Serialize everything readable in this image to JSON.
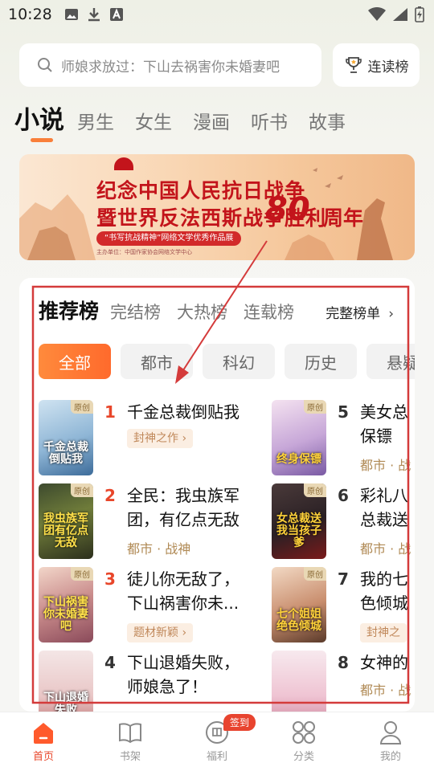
{
  "status_bar": {
    "time": "10:28"
  },
  "search": {
    "placeholder": "师娘求放过：下山去祸害你未婚妻吧",
    "rank_button": "连读榜"
  },
  "category_tabs": [
    "小说",
    "男生",
    "女生",
    "漫画",
    "听书",
    "故事"
  ],
  "banner": {
    "line1": "纪念中国人民抗日战争",
    "line2": "暨世界反法西斯战争胜利",
    "number": "80",
    "suffix": "周年",
    "tag": "“书写抗战精神”网络文学优秀作品展",
    "footer": "主办单位：中国作家协会网络文学中心"
  },
  "ranking": {
    "tabs": [
      "推荐榜",
      "完结榜",
      "大热榜",
      "连载榜"
    ],
    "full_list": "完整榜单",
    "genres": [
      "全部",
      "都市",
      "科幻",
      "历史",
      "悬疑"
    ]
  },
  "books": [
    {
      "rank": "1",
      "title": "千金总裁倒贴我",
      "tag": "封神之作",
      "cover_title": "千金总裁倒贴我",
      "badge": "原创"
    },
    {
      "rank": "2",
      "title": "全民：我虫族军团，有亿点无敌",
      "meta": "都市 · 战神",
      "cover_title": "我虫族军团有亿点无敌",
      "badge": "原创"
    },
    {
      "rank": "3",
      "title": "徒儿你无敌了，下山祸害你未...",
      "tag": "题材新颖",
      "cover_title": "下山祸害你未婚妻吧",
      "badge": "原创"
    },
    {
      "rank": "4",
      "title": "下山退婚失败，师娘急了！",
      "cover_title": "下山退婚失败"
    },
    {
      "rank": "5",
      "title": "美女总保镖",
      "meta": "都市 · 战",
      "cover_title": "终身保镖",
      "badge": "原创"
    },
    {
      "rank": "6",
      "title": "彩礼八总裁送",
      "meta": "都市 · 战",
      "cover_title": "女总裁送我当孩子爹",
      "badge": "原创"
    },
    {
      "rank": "7",
      "title": "我的七色倾城",
      "tag": "封神之",
      "cover_title": "七个姐姐绝色倾城",
      "badge": "原创"
    },
    {
      "rank": "8",
      "title": "女神的",
      "meta": "都市 · 战"
    }
  ],
  "bottom_nav": [
    {
      "label": "首页"
    },
    {
      "label": "书架"
    },
    {
      "label": "福利",
      "badge": "签到"
    },
    {
      "label": "分类"
    },
    {
      "label": "我的"
    }
  ],
  "colors": {
    "accent": "#f97f3a",
    "rank_hot": "#e8462a",
    "annotation": "#d43b3b"
  }
}
